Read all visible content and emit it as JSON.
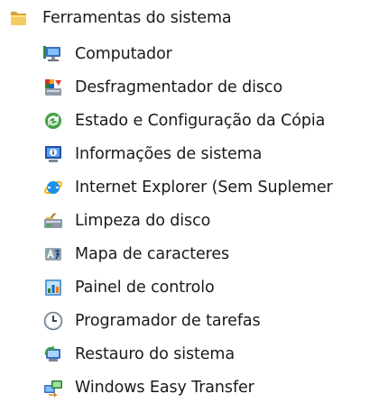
{
  "folder": {
    "label": "Ferramentas do sistema",
    "icon": "folder-icon",
    "color": "#e8b84a"
  },
  "items": [
    {
      "label": "Computador",
      "icon": "computer-icon"
    },
    {
      "label": "Desfragmentador de disco",
      "icon": "defragmenter-icon"
    },
    {
      "label": "Estado e Configuração da Cópia",
      "icon": "backup-status-icon"
    },
    {
      "label": "Informações de sistema",
      "icon": "system-information-icon"
    },
    {
      "label": "Internet Explorer (Sem Suplemer",
      "icon": "internet-explorer-icon"
    },
    {
      "label": "Limpeza do disco",
      "icon": "disk-cleanup-icon"
    },
    {
      "label": "Mapa de caracteres",
      "icon": "character-map-icon"
    },
    {
      "label": "Painel de controlo",
      "icon": "control-panel-icon"
    },
    {
      "label": "Programador de tarefas",
      "icon": "task-scheduler-icon"
    },
    {
      "label": "Restauro do sistema",
      "icon": "system-restore-icon"
    },
    {
      "label": "Windows Easy Transfer",
      "icon": "easy-transfer-icon"
    }
  ]
}
